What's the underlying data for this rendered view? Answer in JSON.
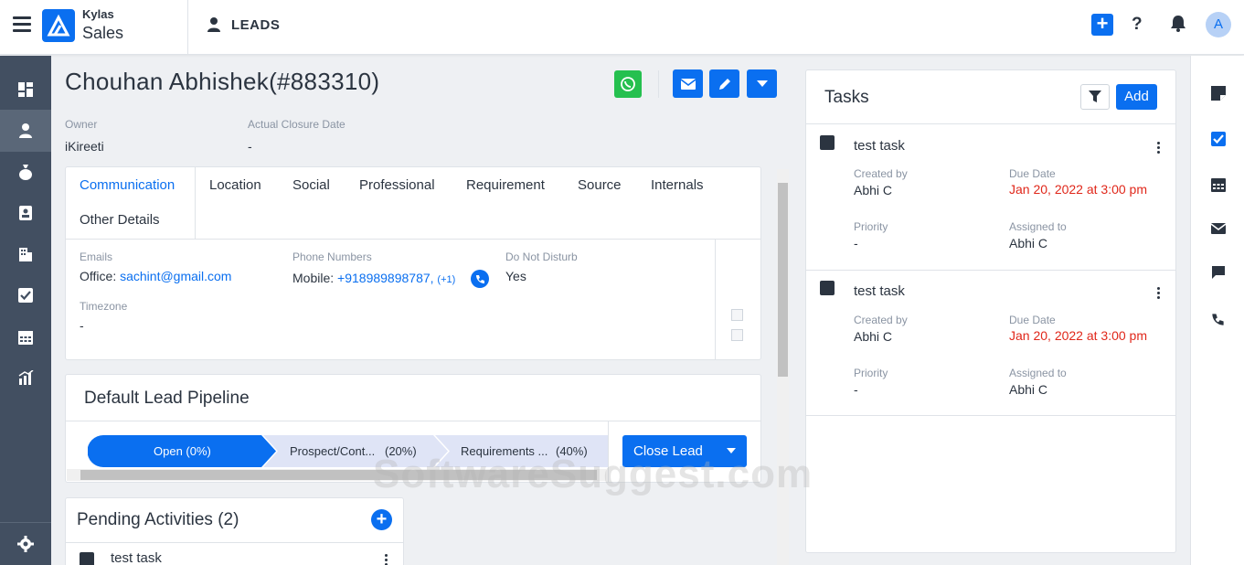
{
  "header": {
    "brand_top": "Kylas",
    "brand_bottom": "Sales",
    "module_title": "LEADS",
    "help_label": "?",
    "avatar_initial": "A",
    "accent_color": "#0a6ff0"
  },
  "sidebar": {
    "items": [
      {
        "icon": "dashboard-icon"
      },
      {
        "icon": "person-icon",
        "active": true
      },
      {
        "icon": "money-bag-icon"
      },
      {
        "icon": "contact-book-icon"
      },
      {
        "icon": "building-icon"
      },
      {
        "icon": "checkbox-icon"
      },
      {
        "icon": "calendar-icon"
      },
      {
        "icon": "reports-icon"
      }
    ],
    "bottom_icon": "gear-icon"
  },
  "lead": {
    "title": "Chouhan Abhishek(#883310)",
    "owner_label": "Owner",
    "owner_value": "iKireeti",
    "closure_label": "Actual Closure Date",
    "closure_value": "-"
  },
  "tabs": [
    "Communication",
    "Location",
    "Social",
    "Professional",
    "Requirement",
    "Source",
    "Internals",
    "Other Details"
  ],
  "communication": {
    "emails_label": "Emails",
    "email_prefix": "Office: ",
    "email_value": "sachint@gmail.com",
    "phones_label": "Phone Numbers",
    "phone_prefix": "Mobile: ",
    "phone_value": "+918989898787,",
    "phone_more": "(+1)",
    "dnd_label": "Do Not Disturb",
    "dnd_value": "Yes",
    "timezone_label": "Timezone",
    "timezone_value": "-"
  },
  "pipeline": {
    "title": "Default Lead Pipeline",
    "stages": [
      {
        "label": "Open (0%)",
        "active": true
      },
      {
        "label": "Prospect/Cont...",
        "pct": "(20%)"
      },
      {
        "label": "Requirements ...",
        "pct": "(40%)"
      }
    ],
    "close_button": "Close Lead"
  },
  "pending": {
    "title": "Pending Activities (2)",
    "first_task": "test task"
  },
  "tasks_panel": {
    "title": "Tasks",
    "add_button": "Add",
    "items": [
      {
        "title": "test task",
        "created_by_label": "Created by",
        "created_by": "Abhi C",
        "due_label": "Due Date",
        "due": "Jan 20, 2022 at 3:00 pm",
        "priority_label": "Priority",
        "priority": "-",
        "assigned_label": "Assigned to",
        "assigned": "Abhi C"
      },
      {
        "title": "test task",
        "created_by_label": "Created by",
        "created_by": "Abhi C",
        "due_label": "Due Date",
        "due": "Jan 20, 2022 at 3:00 pm",
        "priority_label": "Priority",
        "priority": "-",
        "assigned_label": "Assigned to",
        "assigned": "Abhi C"
      }
    ]
  },
  "right_rail": [
    "note-icon",
    "checkbox-icon",
    "calendar-icon",
    "mail-icon",
    "chat-icon",
    "phone-icon"
  ],
  "watermark": "SoftwareSuggest.com"
}
